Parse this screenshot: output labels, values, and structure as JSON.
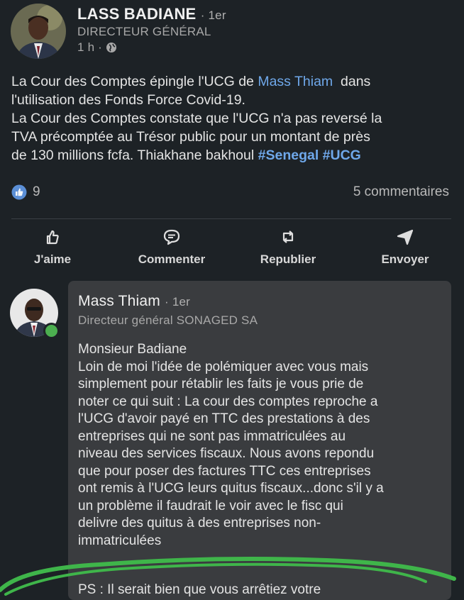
{
  "post": {
    "author_name": "LASS BADIANE",
    "degree": "· 1er",
    "author_title": "DIRECTEUR GÉNÉRAL",
    "time": "1 h ·",
    "text_lines": [
      [
        "La Cour des Comptes épingle l'UCG de ",
        "Mass Thiam",
        "  dans"
      ],
      "l'utilisation des Fonds Force Covid-19.",
      "La Cour des Comptes constate que l'UCG n'a pas reversé la",
      "TVA précomptée au Trésor public pour un montant de près",
      [
        "de 130 millions fcfa. Thiakhane bakhoul ",
        "#Senegal #UCG"
      ]
    ],
    "reactions_count": "9",
    "comments_count": "5 commentaires",
    "colors": {
      "link": "#6fa8ea",
      "reaction": "#5b8fd6"
    }
  },
  "actions": [
    {
      "label": "J'aime",
      "icon": "like-icon"
    },
    {
      "label": "Commenter",
      "icon": "comment-icon"
    },
    {
      "label": "Republier",
      "icon": "repost-icon"
    },
    {
      "label": "Envoyer",
      "icon": "send-icon"
    }
  ],
  "comment": {
    "author_name": "Mass Thiam",
    "degree": "· 1er",
    "author_title": "Directeur général SONAGED SA",
    "text_lines": [
      "Monsieur Badiane",
      "Loin de moi l'idée de polémiquer avec vous mais",
      "simplement pour rétablir les faits je vous prie de",
      "noter ce qui suit : La cour des comptes reproche a",
      "l'UCG d'avoir payé en TTC des prestations à des",
      "entreprises qui ne sont pas immatriculées au",
      "niveau des services fiscaux. Nous avons repondu",
      "que pour poser des factures TTC ces entreprises",
      "ont remis à l'UCG leurs quitus fiscaux...donc s'il y a",
      "un problème il faudrait le voir avec le fisc qui",
      "delivre des quitus à des entreprises non-",
      "immatriculées"
    ],
    "ps_line": "PS : Il serait bien que vous arrêtiez votre"
  }
}
